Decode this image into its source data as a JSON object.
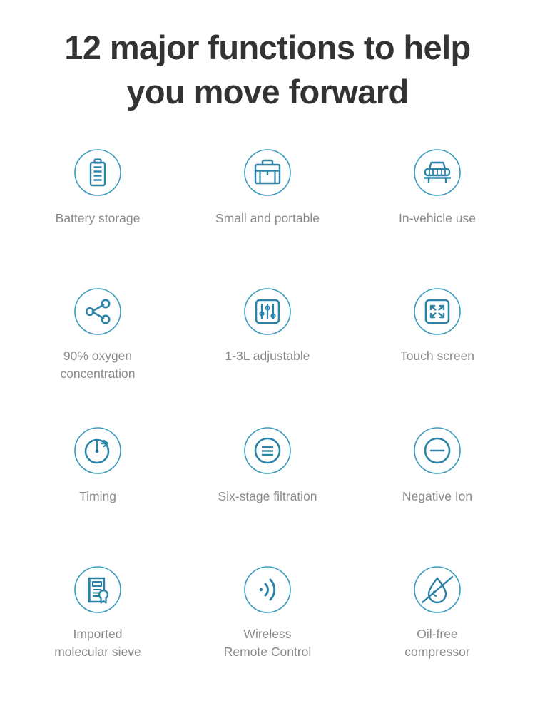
{
  "header": {
    "title": "12 major functions to help you move forward",
    "title_line1": "12 major functions to help",
    "title_line2": "you move forward",
    "title_color": "#333333"
  },
  "theme": {
    "background": "#ffffff",
    "icon_accent": "#2b84a8",
    "icon_ring": "#3d9bbd",
    "label_color": "#8a8a8a"
  },
  "features": [
    {
      "label": "Battery storage",
      "icon": "battery-icon",
      "row": 1,
      "col": 1
    },
    {
      "label": "Small and portable",
      "icon": "briefcase-icon",
      "row": 1,
      "col": 2
    },
    {
      "label": "In-vehicle use",
      "icon": "car-front-icon",
      "row": 1,
      "col": 3
    },
    {
      "label": "90% oxygen\nconcentration",
      "icon": "molecule-share-icon",
      "row": 2,
      "col": 1
    },
    {
      "label": "1-3L adjustable",
      "icon": "sliders-icon",
      "row": 2,
      "col": 2
    },
    {
      "label": "Touch screen",
      "icon": "expand-arrows-icon",
      "row": 2,
      "col": 3
    },
    {
      "label": "Timing",
      "icon": "stopwatch-icon",
      "row": 3,
      "col": 1
    },
    {
      "label": "Six-stage filtration",
      "icon": "filter-layers-icon",
      "row": 3,
      "col": 2
    },
    {
      "label": "Negative Ion",
      "icon": "minus-circle-icon",
      "row": 3,
      "col": 3
    },
    {
      "label": "Imported\nmolecular sieve",
      "icon": "certificate-icon",
      "row": 4,
      "col": 1
    },
    {
      "label": "Wireless\nRemote Control",
      "icon": "wireless-signal-icon",
      "row": 4,
      "col": 2
    },
    {
      "label": "Oil-free\ncompressor",
      "icon": "no-oil-drop-icon",
      "row": 4,
      "col": 3
    }
  ]
}
